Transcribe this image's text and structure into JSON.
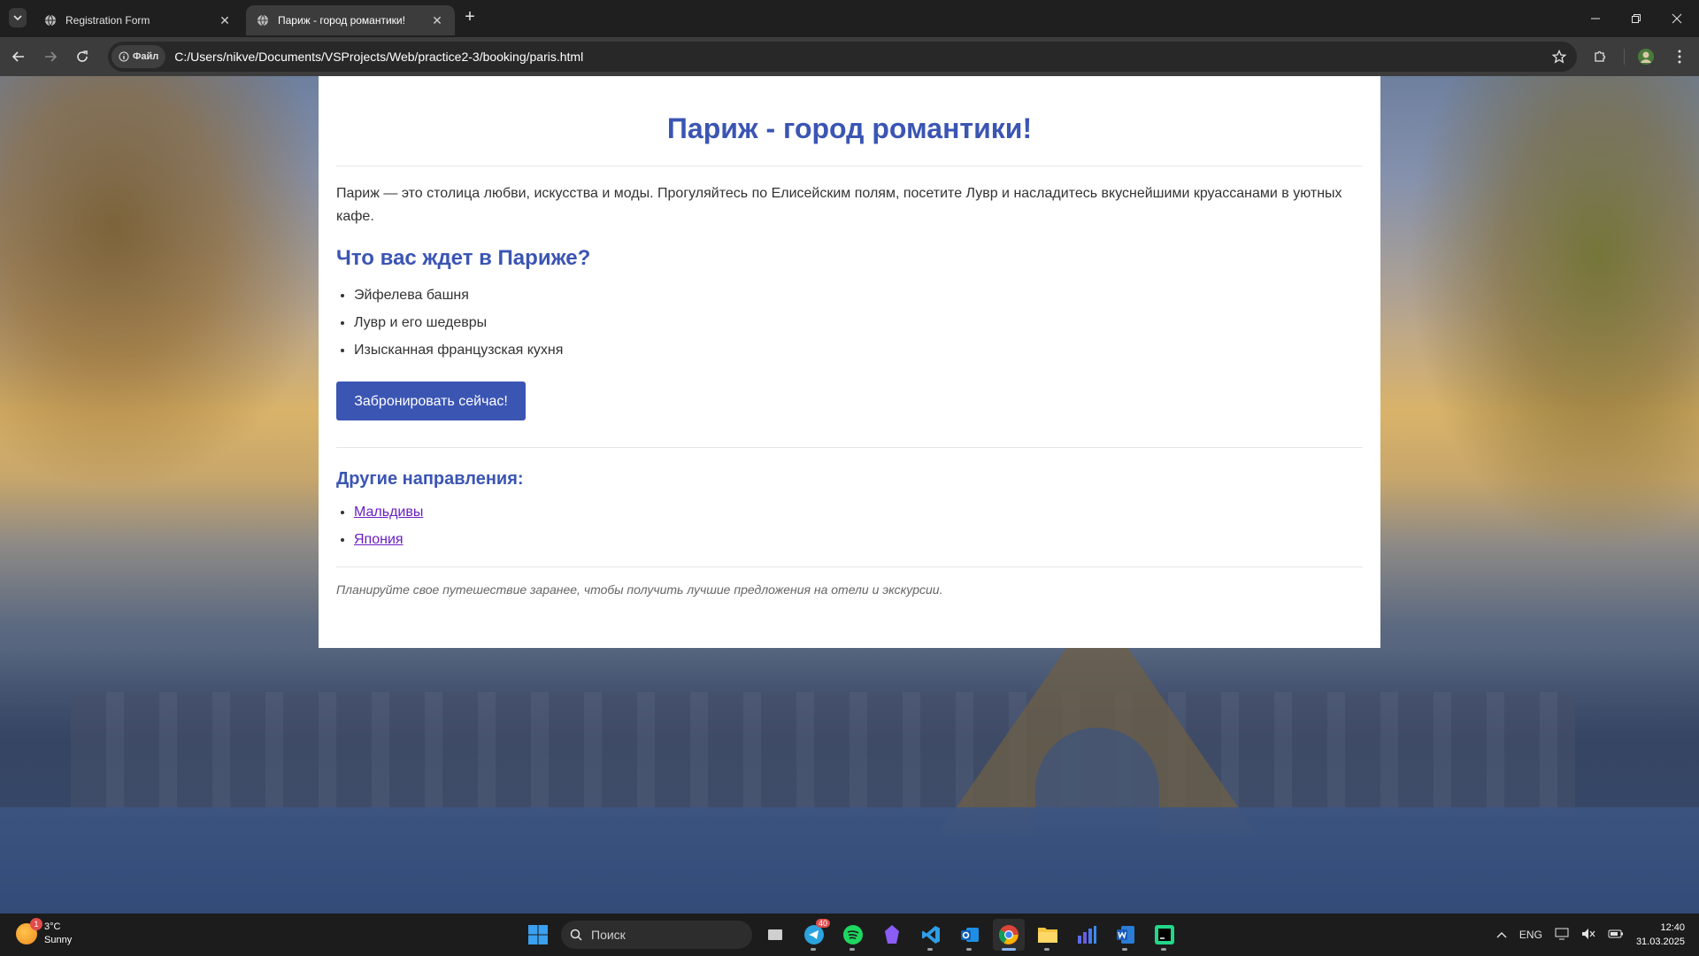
{
  "browser": {
    "tabs": [
      {
        "label": "Registration Form"
      },
      {
        "label": "Париж - город романтики!"
      }
    ],
    "scheme_chip": "Файл",
    "url": "C:/Users/nikve/Documents/VSProjects/Web/practice2-3/booking/paris.html"
  },
  "page": {
    "title": "Париж - город романтики!",
    "intro": "Париж — это столица любви, искусства и моды. Прогуляйтесь по Елисейским полям, посетите Лувр и насладитесь вкуснейшими круассанами в уютных кафе.",
    "section_title": "Что вас ждет в Париже?",
    "features": [
      "Эйфелева башня",
      "Лувр и его шедевры",
      "Изысканная французская кухня"
    ],
    "book_button": "Забронировать сейчас!",
    "other_title": "Другие направления:",
    "destinations": [
      "Мальдивы",
      "Япония"
    ],
    "footnote": "Планируйте свое путешествие заранее, чтобы получить лучшие предложения на отели и экскурсии."
  },
  "taskbar": {
    "weather_temp": "3°C",
    "weather_desc": "Sunny",
    "weather_badge": "1",
    "search_placeholder": "Поиск",
    "lang": "ENG",
    "time": "12:40",
    "date": "31.03.2025",
    "telegram_badge": "40"
  },
  "colors": {
    "accent": "#3b55b3",
    "link": "#6a1ec2"
  }
}
